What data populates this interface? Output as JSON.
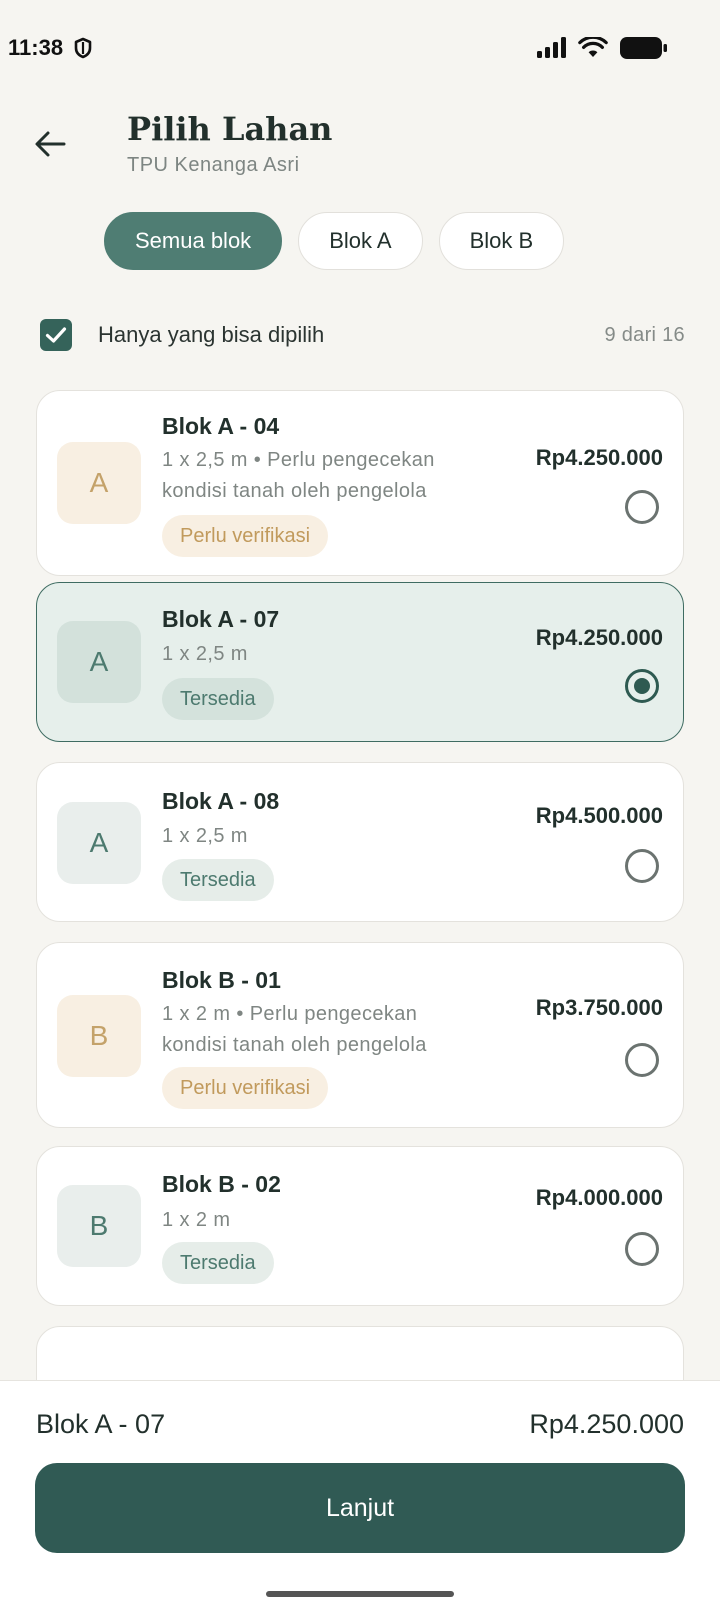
{
  "status_bar": {
    "time": "11:38"
  },
  "header": {
    "title": "Pilih Lahan",
    "subtitle": "TPU Kenanga Asri"
  },
  "chips": [
    {
      "label": "Semua blok",
      "active": true
    },
    {
      "label": "Blok A",
      "active": false
    },
    {
      "label": "Blok B",
      "active": false
    }
  ],
  "filter": {
    "label": "Hanya yang bisa dipilih",
    "checked": true,
    "count": "9 dari 16"
  },
  "plots": [
    {
      "letter": "A",
      "name": "Blok A - 04",
      "desc": "1 x 2,5 m • Perlu pengecekan kondisi tanah oleh pengelola",
      "status": "Perlu verifikasi",
      "status_type": "warn",
      "price": "Rp4.250.000",
      "selected": false
    },
    {
      "letter": "A",
      "name": "Blok A - 07",
      "desc": "1 x 2,5 m",
      "status": "Tersedia",
      "status_type": "ok",
      "price": "Rp4.250.000",
      "selected": true
    },
    {
      "letter": "A",
      "name": "Blok A - 08",
      "desc": "1 x 2,5 m",
      "status": "Tersedia",
      "status_type": "ok",
      "price": "Rp4.500.000",
      "selected": false
    },
    {
      "letter": "B",
      "name": "Blok B - 01",
      "desc": "1 x 2 m • Perlu pengecekan kondisi tanah oleh pengelola",
      "status": "Perlu verifikasi",
      "status_type": "warn",
      "price": "Rp3.750.000",
      "selected": false
    },
    {
      "letter": "B",
      "name": "Blok B - 02",
      "desc": "1 x 2 m",
      "status": "Tersedia",
      "status_type": "ok",
      "price": "Rp4.000.000",
      "selected": false
    }
  ],
  "summary": {
    "name": "Blok A - 07",
    "price": "Rp4.250.000"
  },
  "cta": {
    "label": "Lanjut"
  },
  "colors": {
    "primary": "#305a54",
    "chip_active": "#4f7d73",
    "warn_bg": "#f8efe2",
    "warn_text": "#c19a5c",
    "ok_bg": "#e6ede9",
    "ok_text": "#4d7a6f",
    "selected_bg": "#e6efeb"
  }
}
